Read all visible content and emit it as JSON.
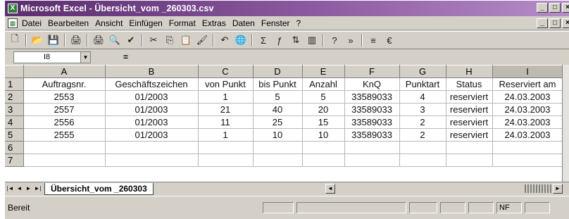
{
  "window": {
    "title": "Microsoft Excel - Übersicht_vom _260303.csv",
    "app_icon": "X",
    "min_label": "_",
    "max_label": "□",
    "close_label": "×"
  },
  "menu": {
    "items": [
      "Datei",
      "Bearbeiten",
      "Ansicht",
      "Einfügen",
      "Format",
      "Extras",
      "Daten",
      "Fenster",
      "?"
    ]
  },
  "toolbar": {
    "icons": [
      "new-icon",
      "open-icon",
      "save-icon",
      "permission-icon",
      "print-icon",
      "print-preview-icon",
      "spelling-icon",
      "cut-icon",
      "copy-icon",
      "paste-icon",
      "format-painter-icon",
      "undo-icon",
      "hyperlink-icon",
      "autosum-icon",
      "function-icon",
      "sort-icon",
      "chart-icon",
      "help-icon",
      "more-icon",
      "align-icon",
      "currency-icon"
    ],
    "glyphs": [
      "🗋",
      "📂",
      "💾",
      "🖨",
      "🖨",
      "🔍",
      "✔",
      "✂",
      "⎘",
      "📋",
      "🖌",
      "↶",
      "🌐",
      "Σ",
      "ƒ",
      "⇅",
      "▥",
      "?",
      "»",
      "≡",
      "€"
    ]
  },
  "formula_bar": {
    "cell_ref": "I8",
    "equals": "="
  },
  "sheet": {
    "columns": [
      "A",
      "B",
      "C",
      "D",
      "E",
      "F",
      "G",
      "H",
      "I"
    ],
    "rows": [
      [
        "Auftragsnr.",
        "Geschäftszeichen",
        "von Punkt",
        "bis Punkt",
        "Anzahl",
        "KnQ",
        "Punktart",
        "Status",
        "Reserviert am"
      ],
      [
        "2553",
        "01/2003",
        "1",
        "5",
        "5",
        "33589033",
        "4",
        "reserviert",
        "24.03.2003"
      ],
      [
        "2557",
        "01/2003",
        "21",
        "40",
        "20",
        "33589033",
        "3",
        "reserviert",
        "24.03.2003"
      ],
      [
        "2556",
        "01/2003",
        "11",
        "25",
        "15",
        "33589033",
        "2",
        "reserviert",
        "24.03.2003"
      ],
      [
        "2555",
        "01/2003",
        "1",
        "10",
        "10",
        "33589033",
        "2",
        "reserviert",
        "24.03.2003"
      ],
      [
        "",
        "",
        "",
        "",
        "",
        "",
        "",
        "",
        ""
      ],
      [
        "",
        "",
        "",
        "",
        "",
        "",
        "",
        "",
        ""
      ]
    ],
    "row_numbers": [
      "1",
      "2",
      "3",
      "4",
      "5",
      "6",
      "7"
    ],
    "active_column": "I"
  },
  "tabs": {
    "nav": [
      "|◄",
      "◄",
      "►",
      "►|"
    ],
    "active_tab": "Übersicht_vom _260303"
  },
  "status": {
    "text": "Bereit",
    "mode": "NF"
  }
}
